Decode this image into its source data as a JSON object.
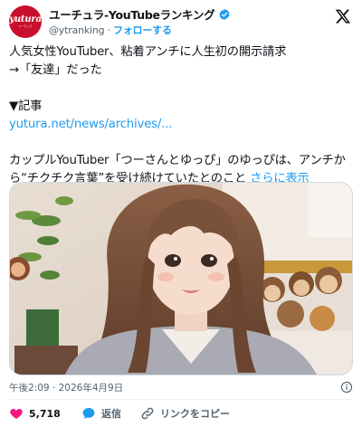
{
  "author": {
    "avatar_text": "yutura",
    "avatar_sub": "ユーチュラ",
    "display_name": "ユーチュラ-YouTubeランキング",
    "handle": "@ytranking",
    "separator": "·",
    "follow_label": "フォローする"
  },
  "tweet": {
    "text_main": "人気女性YouTuber、粘着アンチに人生初の開示請求\n→「友達」だった\n\n▼記事\n",
    "link": "yutura.net/news/archives/...",
    "text_after": "\n\nカップルYouTuber「つーさんとゆっぴ」のゆっぴは、アンチから“チクチク言葉”を受け続けていたとのこと ",
    "show_more": "さらに表示"
  },
  "meta": {
    "time": "午後2:09 · 2026年4月9日"
  },
  "actions": {
    "likes": "5,718",
    "reply": "返信",
    "copy_link": "リンクをコピー"
  },
  "colors": {
    "brand": "#c8102e",
    "link": "#1d9bf0",
    "like": "#f91880",
    "muted": "#536471"
  }
}
